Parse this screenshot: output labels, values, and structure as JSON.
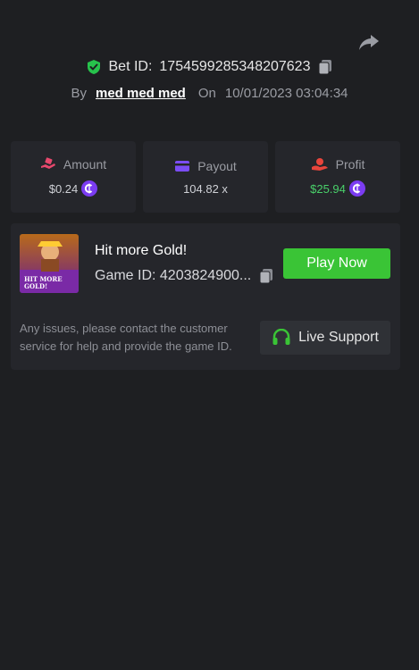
{
  "header": {
    "bet_id_label": "Bet ID:",
    "bet_id_value": "1754599285348207623",
    "by_label": "By",
    "username": "med med med",
    "on_label": "On",
    "datetime": "10/01/2023 03:04:34"
  },
  "stats": {
    "amount": {
      "label": "Amount",
      "value": "$0.24"
    },
    "payout": {
      "label": "Payout",
      "value": "104.82 x"
    },
    "profit": {
      "label": "Profit",
      "value": "$25.94"
    }
  },
  "game": {
    "title": "Hit more Gold!",
    "game_id": "Game ID: 4203824900...",
    "play_button": "Play Now",
    "thumbnail_text_1": "HIT MORE",
    "thumbnail_text_2": "GOLD!"
  },
  "support": {
    "text": "Any issues, please contact the customer service for help and provide the game ID.",
    "button": "Live Support"
  },
  "colors": {
    "background": "#1e1f22",
    "card": "#25262b",
    "accent_green": "#3ac436",
    "profit_green": "#49d06a",
    "coin_purple": "#7b3cf2",
    "shield_green": "#27c24c",
    "amount_icon": "#e8486d",
    "payout_icon": "#7b4df5",
    "profit_icon": "#e8453c"
  },
  "icons": [
    "share-icon",
    "shield-check-icon",
    "copy-icon",
    "amount-icon",
    "payout-card-icon",
    "profit-hand-icon",
    "coin-icon",
    "headset-icon"
  ]
}
